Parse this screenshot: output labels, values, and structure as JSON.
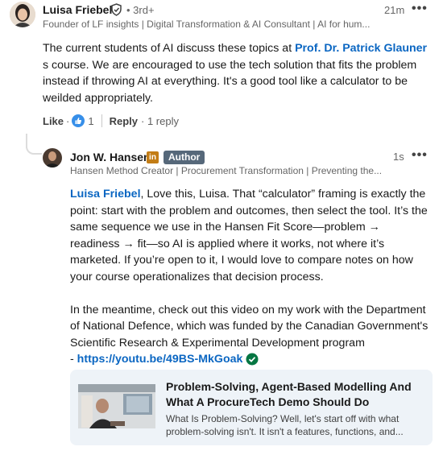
{
  "comment": {
    "author": "Luisa Friebel",
    "degree": "• 3rd+",
    "headline": "Founder of LF insights | Digital Transformation & AI Consultant | AI for hum...",
    "time": "21m",
    "more": "•••",
    "text_pre": "The current students of AI discuss these topics at ",
    "mention": "Prof. Dr. Patrick Glauner",
    "text_post": " s course. We are encouraged to use the tech solution that fits the problem instead if throwing AI at everything. It's a good tool like a calculator to be weilded appropriately.",
    "like_label": "Like",
    "dot": "·",
    "like_count": "1",
    "reply_label": "Reply",
    "reply_count": "· 1 reply"
  },
  "reply": {
    "author": "Jon W. Hansen",
    "linkedin_badge": "in",
    "author_badge": "Author",
    "headline": "Hansen Method Creator | Procurement Transformation | Preventing the...",
    "time": "1s",
    "more": "•••",
    "mention": "Luisa Friebel",
    "para1": ", Love this, Luisa. That “calculator” framing is exactly the point: start with the problem and outcomes, then select the tool. It’s the same sequence we use in the Hansen Fit Score—problem → readiness → fit—so AI is applied where it works, not where it’s marketed. If you’re open to it, I would love to compare notes on how your course operationalizes that decision process.",
    "para2": "In the meantime, check out this video on my work with the Department of National Defence, which was funded by the Canadian Government's Scientific Research & Experimental Development program",
    "link_prefix": "- ",
    "link": "https://youtu.be/49BS-MkGoak"
  },
  "preview": {
    "title": "Problem-Solving, Agent-Based Modelling And What A ProcureTech Demo Should Do",
    "description": "What Is Problem-Solving? Well, let's start off with what problem-solving isn't. It isn't a features, functions, and..."
  },
  "colors": {
    "link": "#0a66c2",
    "author_badge": "#56687a",
    "verified": "#057642",
    "card_bg": "#eef3f8"
  }
}
